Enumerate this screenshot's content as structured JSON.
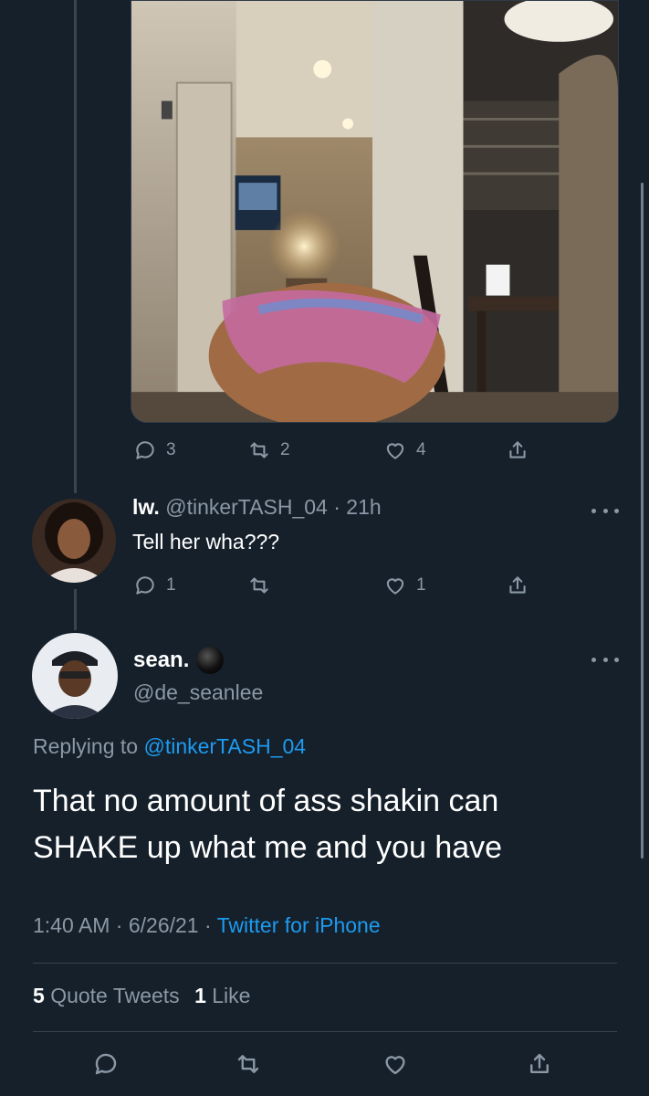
{
  "top_tweet": {
    "media_description_icon": "image-icon",
    "reply_count": "3",
    "retweet_count": "2",
    "like_count": "4"
  },
  "reply_tweet": {
    "display_name": "lw.",
    "handle": "@tinkerTASH_04",
    "separator": "·",
    "time": "21h",
    "text": "Tell her wha???",
    "reply_count": "1",
    "retweet_count": "",
    "like_count": "1"
  },
  "main_tweet": {
    "display_name": "sean.",
    "handle": "@de_seanlee",
    "replying_prefix": "Replying to",
    "replying_to": "@tinkerTASH_04",
    "text": "That no amount of ass shakin can SHAKE up what me and you have",
    "time": "1:40 AM",
    "sep1": "·",
    "date": "6/26/21",
    "sep2": "·",
    "source": "Twitter for iPhone",
    "quote_count": "5",
    "quote_label": "Quote Tweets",
    "like_count": "1",
    "like_label": "Like"
  },
  "colors": {
    "background": "#15202b",
    "text_secondary": "#8b98a5",
    "link": "#1d9bf0",
    "divider": "#38444d"
  }
}
